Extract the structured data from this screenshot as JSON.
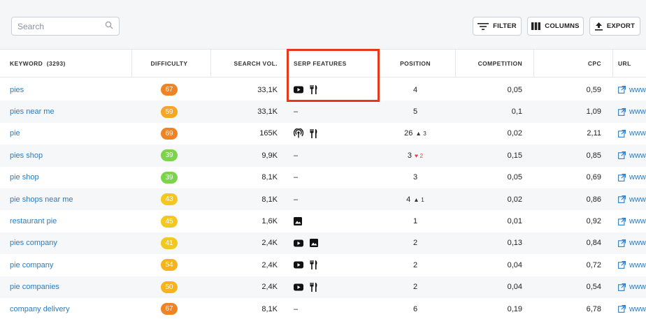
{
  "search": {
    "placeholder": "Search"
  },
  "toolbar": {
    "filter_label": "FILTER",
    "columns_label": "COLUMNS",
    "export_label": "EXPORT"
  },
  "columns": {
    "keyword": "KEYWORD",
    "keyword_count": "(3293)",
    "difficulty": "DIFFICULTY",
    "search_vol": "SEARCH VOL.",
    "serp": "SERP FEATURES",
    "position": "POSITION",
    "competition": "COMPETITION",
    "cpc": "CPC",
    "url": "URL"
  },
  "colors": {
    "accent_link": "#2a7bbf",
    "highlight": "#e8381c",
    "diff_orange": "#f08323",
    "diff_amber": "#f5b41d",
    "diff_yellow": "#f3c81e",
    "diff_green": "#7bd44a",
    "diff_lime": "#8fd847"
  },
  "rows": [
    {
      "keyword": "pies",
      "difficulty": "67",
      "diff_color": "#f08323",
      "volume": "33,1K",
      "serp": [
        "youtube-icon",
        "restaurant-icon"
      ],
      "serp_text": "",
      "position": "4",
      "change": "",
      "change_dir": "",
      "competition": "0,05",
      "cpc": "0,59",
      "url": "www"
    },
    {
      "keyword": "pies near me",
      "difficulty": "59",
      "diff_color": "#f5a623",
      "volume": "33,1K",
      "serp": [],
      "serp_text": "–",
      "position": "5",
      "change": "",
      "change_dir": "",
      "competition": "0,1",
      "cpc": "1,09",
      "url": "www"
    },
    {
      "keyword": "pie",
      "difficulty": "69",
      "diff_color": "#f08323",
      "volume": "165K",
      "serp": [
        "podcast-icon",
        "restaurant-icon"
      ],
      "serp_text": "",
      "position": "26",
      "change": "3",
      "change_dir": "up",
      "competition": "0,02",
      "cpc": "2,11",
      "url": "www"
    },
    {
      "keyword": "pies shop",
      "difficulty": "39",
      "diff_color": "#7bd44a",
      "volume": "9,9K",
      "serp": [],
      "serp_text": "–",
      "position": "3",
      "change": "2",
      "change_dir": "down",
      "competition": "0,15",
      "cpc": "0,85",
      "url": "www"
    },
    {
      "keyword": "pie shop",
      "difficulty": "39",
      "diff_color": "#7bd44a",
      "volume": "8,1K",
      "serp": [],
      "serp_text": "–",
      "position": "3",
      "change": "",
      "change_dir": "",
      "competition": "0,05",
      "cpc": "0,69",
      "url": "www"
    },
    {
      "keyword": "pie shops near me",
      "difficulty": "43",
      "diff_color": "#f3c81e",
      "volume": "8,1K",
      "serp": [],
      "serp_text": "–",
      "position": "4",
      "change": "1",
      "change_dir": "up",
      "competition": "0,02",
      "cpc": "0,86",
      "url": "www"
    },
    {
      "keyword": "restaurant pie",
      "difficulty": "45",
      "diff_color": "#f3c81e",
      "volume": "1,6K",
      "serp": [
        "image-icon"
      ],
      "serp_text": "",
      "position": "1",
      "change": "",
      "change_dir": "",
      "competition": "0,01",
      "cpc": "0,92",
      "url": "www"
    },
    {
      "keyword": "pies company",
      "difficulty": "41",
      "diff_color": "#f3c81e",
      "volume": "2,4K",
      "serp": [
        "youtube-icon",
        "image-icon"
      ],
      "serp_text": "",
      "position": "2",
      "change": "",
      "change_dir": "",
      "competition": "0,13",
      "cpc": "0,84",
      "url": "www"
    },
    {
      "keyword": "pie company",
      "difficulty": "54",
      "diff_color": "#f5b41d",
      "volume": "2,4K",
      "serp": [
        "youtube-icon",
        "restaurant-icon"
      ],
      "serp_text": "",
      "position": "2",
      "change": "",
      "change_dir": "",
      "competition": "0,04",
      "cpc": "0,72",
      "url": "www"
    },
    {
      "keyword": "pie companies",
      "difficulty": "50",
      "diff_color": "#f5b41d",
      "volume": "2,4K",
      "serp": [
        "youtube-icon",
        "restaurant-icon"
      ],
      "serp_text": "",
      "position": "2",
      "change": "",
      "change_dir": "",
      "competition": "0,04",
      "cpc": "0,54",
      "url": "www"
    },
    {
      "keyword": "company delivery",
      "difficulty": "67",
      "diff_color": "#f08323",
      "volume": "8,1K",
      "serp": [],
      "serp_text": "–",
      "position": "6",
      "change": "",
      "change_dir": "",
      "competition": "0,19",
      "cpc": "6,78",
      "url": "www"
    }
  ]
}
